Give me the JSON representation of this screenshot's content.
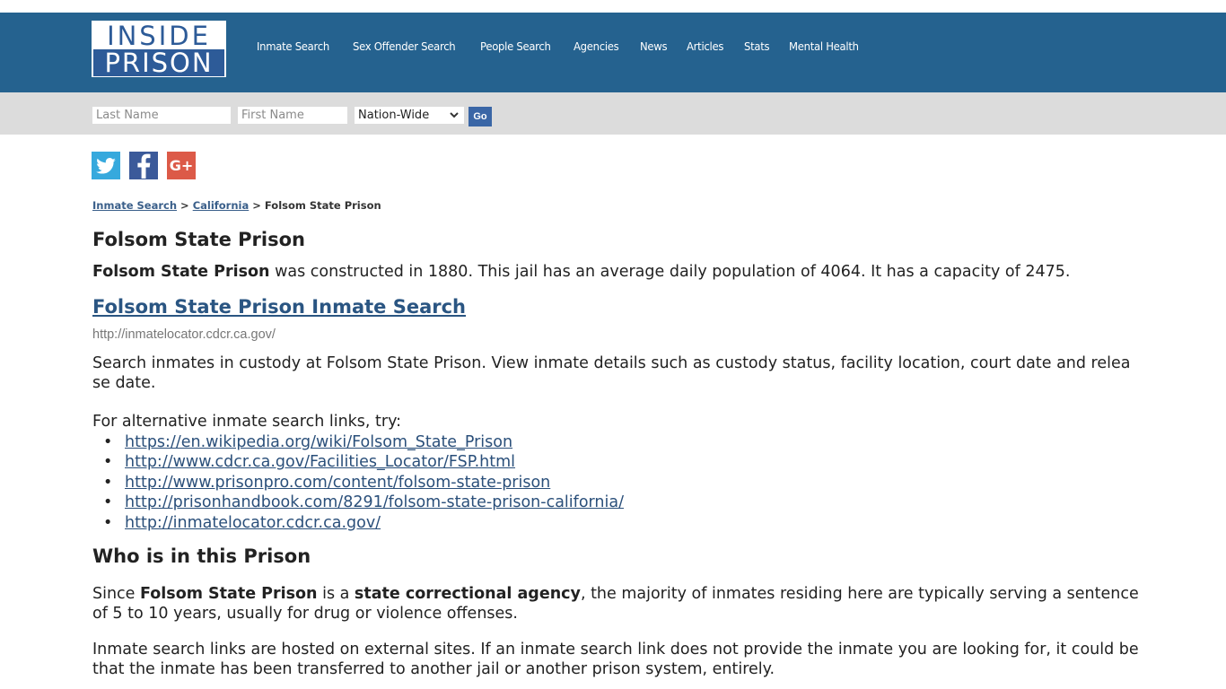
{
  "logo": {
    "line1": "INSIDE",
    "line2": "PRISON"
  },
  "nav": {
    "items": [
      {
        "label": "Inmate Search"
      },
      {
        "label": "Sex Offender Search"
      },
      {
        "label": "People Search"
      },
      {
        "label": "Agencies"
      },
      {
        "label": "News"
      },
      {
        "label": "Articles"
      },
      {
        "label": "Stats"
      },
      {
        "label": "Mental Health"
      }
    ]
  },
  "search": {
    "last_name_placeholder": "Last Name",
    "first_name_placeholder": "First Name",
    "scope_selected": "Nation-Wide",
    "go_label": "Go"
  },
  "social": {
    "twitter": "twitter",
    "facebook": "f",
    "google_plus": "G+"
  },
  "breadcrumb": {
    "items": [
      {
        "label": "Inmate Search"
      },
      {
        "label": "California"
      }
    ],
    "current": "Folsom State Prison",
    "separator": ">"
  },
  "main": {
    "title": "Folsom State Prison",
    "intro_bold": "Folsom State Prison",
    "intro_text": " was constructed in 1880. This jail has an average daily population of 4064. It has a capacity of 2475.",
    "search_link_label": "Folsom State Prison Inmate Search",
    "search_link_url": "http://inmatelocator.cdcr.ca.gov/",
    "description": "Search inmates in custody at Folsom State Prison. View inmate details such as custody status, facility location, court date and release date.",
    "alt_links_intro": "For alternative inmate search links, try:",
    "alt_links": [
      {
        "label": "https://en.wikipedia.org/wiki/Folsom_State_Prison"
      },
      {
        "label": "http://www.cdcr.ca.gov/Facilities_Locator/FSP.html"
      },
      {
        "label": "http://www.prisonpro.com/content/folsom-state-prison"
      },
      {
        "label": "http://prisonhandbook.com/8291/folsom-state-prison-california/"
      },
      {
        "label": "http://inmatelocator.cdcr.ca.gov/"
      }
    ],
    "who_heading": "Who is in this Prison",
    "who_p1": {
      "t1": "Since ",
      "b1": "Folsom State Prison",
      "t2": " is a ",
      "b2": "state correctional agency",
      "t3": ", the majority of inmates residing here are typically serving a sentence of 5 to 10 years, usually for drug or violence offenses."
    },
    "who_p2": "Inmate search links are hosted on external sites. If an inmate search link does not provide the inmate you are looking for, it could be that the inmate has been transferred to another jail or another prison system, entirely."
  },
  "colors": {
    "header_bg": "#25628f",
    "search_bar_bg": "#dcdcdc",
    "logo_blue": "#2d5b98",
    "link": "#2a5582",
    "go_button": "#3a66a6",
    "twitter": "#36a9dd",
    "facebook": "#3b5a9a",
    "google_plus": "#dc5a48"
  }
}
